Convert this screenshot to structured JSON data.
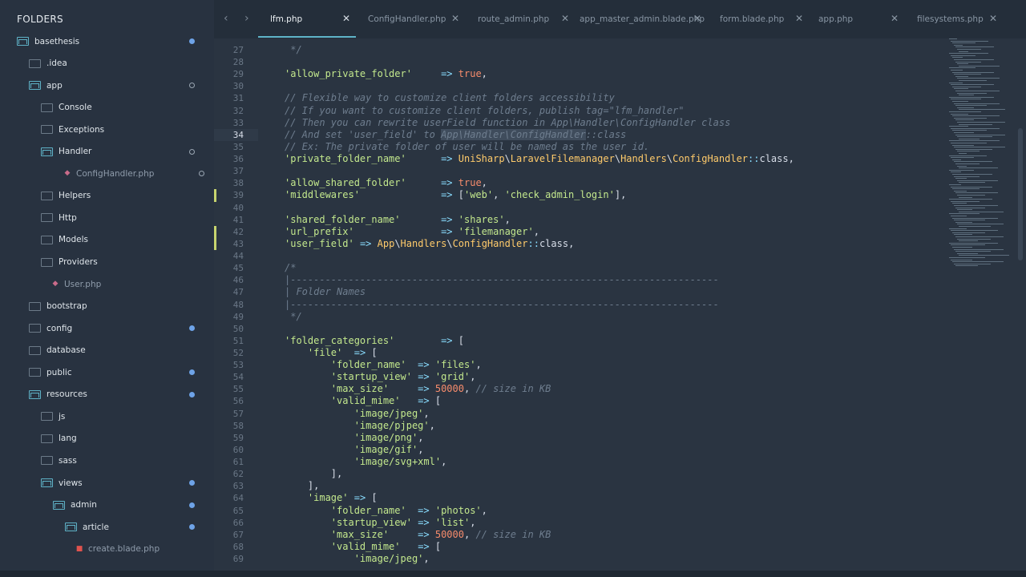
{
  "sidebar": {
    "header": "FOLDERS",
    "items": [
      {
        "label": "basethesis",
        "kind": "folder-open",
        "indent": 0,
        "marker": "fill"
      },
      {
        "label": ".idea",
        "kind": "folder",
        "indent": 1,
        "marker": ""
      },
      {
        "label": "app",
        "kind": "folder-open",
        "indent": 1,
        "marker": "ring"
      },
      {
        "label": "Console",
        "kind": "folder",
        "indent": 2,
        "marker": ""
      },
      {
        "label": "Exceptions",
        "kind": "folder",
        "indent": 2,
        "marker": ""
      },
      {
        "label": "Handler",
        "kind": "folder-open",
        "indent": 2,
        "marker": "ring"
      },
      {
        "label": "ConfigHandler.php",
        "kind": "php",
        "indent": 3,
        "marker": "ring"
      },
      {
        "label": "Helpers",
        "kind": "folder",
        "indent": 2,
        "marker": ""
      },
      {
        "label": "Http",
        "kind": "folder",
        "indent": 2,
        "marker": ""
      },
      {
        "label": "Models",
        "kind": "folder",
        "indent": 2,
        "marker": ""
      },
      {
        "label": "Providers",
        "kind": "folder",
        "indent": 2,
        "marker": ""
      },
      {
        "label": "User.php",
        "kind": "php",
        "indent": 2,
        "marker": ""
      },
      {
        "label": "bootstrap",
        "kind": "folder",
        "indent": 1,
        "marker": ""
      },
      {
        "label": "config",
        "kind": "folder",
        "indent": 1,
        "marker": "fill"
      },
      {
        "label": "database",
        "kind": "folder",
        "indent": 1,
        "marker": ""
      },
      {
        "label": "public",
        "kind": "folder",
        "indent": 1,
        "marker": "fill"
      },
      {
        "label": "resources",
        "kind": "folder-open",
        "indent": 1,
        "marker": "fill"
      },
      {
        "label": "js",
        "kind": "folder",
        "indent": 2,
        "marker": ""
      },
      {
        "label": "lang",
        "kind": "folder",
        "indent": 2,
        "marker": ""
      },
      {
        "label": "sass",
        "kind": "folder",
        "indent": 2,
        "marker": ""
      },
      {
        "label": "views",
        "kind": "folder-open",
        "indent": 2,
        "marker": "fill"
      },
      {
        "label": "admin",
        "kind": "folder-open",
        "indent": 3,
        "marker": "fill"
      },
      {
        "label": "article",
        "kind": "folder-open",
        "indent": 4,
        "marker": "fill"
      },
      {
        "label": "create.blade.php",
        "kind": "blade",
        "indent": 4,
        "marker": ""
      }
    ]
  },
  "tabs": [
    {
      "label": "lfm.php",
      "active": true
    },
    {
      "label": "ConfigHandler.php",
      "active": false
    },
    {
      "label": "route_admin.php",
      "active": false
    },
    {
      "label": "app_master_admin.blade.php",
      "active": false
    },
    {
      "label": "form.blade.php",
      "active": false
    },
    {
      "label": "app.php",
      "active": false
    },
    {
      "label": "filesystems.php",
      "active": false
    }
  ],
  "icons": {
    "back": "chevron-left-icon",
    "forward": "chevron-right-icon",
    "close": "close-icon"
  },
  "editor": {
    "current_line": 34,
    "lines": [
      {
        "n": 27,
        "t": [
          [
            "c",
            " */"
          ]
        ]
      },
      {
        "n": 28,
        "t": []
      },
      {
        "n": 29,
        "t": [
          [
            "s",
            "'allow_private_folder'"
          ],
          [
            "p",
            "     "
          ],
          [
            "o",
            "=>"
          ],
          [
            "p",
            " "
          ],
          [
            "k",
            "true"
          ],
          [
            "p",
            ","
          ]
        ]
      },
      {
        "n": 30,
        "t": []
      },
      {
        "n": 31,
        "t": [
          [
            "c",
            "// Flexible way to customize client folders accessibility"
          ]
        ]
      },
      {
        "n": 32,
        "t": [
          [
            "c",
            "// If you want to customize client folders, publish tag=\"lfm_handler\""
          ]
        ]
      },
      {
        "n": 33,
        "t": [
          [
            "c",
            "// Then you can rewrite userField function in App\\Handler\\ConfigHandler class"
          ]
        ]
      },
      {
        "n": 34,
        "t": [
          [
            "c",
            "// And set 'user_field' to "
          ],
          [
            "csel",
            "App\\Handler\\ConfigHandler"
          ],
          [
            "c",
            "::class"
          ]
        ]
      },
      {
        "n": 35,
        "t": [
          [
            "c",
            "// Ex: The private folder of user will be named as the user id."
          ]
        ]
      },
      {
        "n": 36,
        "t": [
          [
            "s",
            "'private_folder_name'"
          ],
          [
            "p",
            "      "
          ],
          [
            "o",
            "=>"
          ],
          [
            "p",
            " "
          ],
          [
            "cls",
            "UniSharp"
          ],
          [
            "p",
            "\\"
          ],
          [
            "cls",
            "LaravelFilemanager"
          ],
          [
            "p",
            "\\"
          ],
          [
            "cls",
            "Handlers"
          ],
          [
            "p",
            "\\"
          ],
          [
            "cls",
            "ConfigHandler"
          ],
          [
            "o",
            "::"
          ],
          [
            "p",
            "class,"
          ]
        ]
      },
      {
        "n": 37,
        "t": []
      },
      {
        "n": 38,
        "t": [
          [
            "s",
            "'allow_shared_folder'"
          ],
          [
            "p",
            "      "
          ],
          [
            "o",
            "=>"
          ],
          [
            "p",
            " "
          ],
          [
            "k",
            "true"
          ],
          [
            "p",
            ","
          ]
        ]
      },
      {
        "n": 39,
        "t": [
          [
            "s",
            "'middlewares'"
          ],
          [
            "p",
            "              "
          ],
          [
            "o",
            "=>"
          ],
          [
            "p",
            " ["
          ],
          [
            "s",
            "'web'"
          ],
          [
            "p",
            ", "
          ],
          [
            "s",
            "'check_admin_login'"
          ],
          [
            "p",
            "],"
          ]
        ]
      },
      {
        "n": 40,
        "t": []
      },
      {
        "n": 41,
        "t": [
          [
            "s",
            "'shared_folder_name'"
          ],
          [
            "p",
            "       "
          ],
          [
            "o",
            "=>"
          ],
          [
            "p",
            " "
          ],
          [
            "s",
            "'shares'"
          ],
          [
            "p",
            ","
          ]
        ]
      },
      {
        "n": 42,
        "t": [
          [
            "s",
            "'url_prefix'"
          ],
          [
            "p",
            "               "
          ],
          [
            "o",
            "=>"
          ],
          [
            "p",
            " "
          ],
          [
            "s",
            "'filemanager'"
          ],
          [
            "p",
            ","
          ]
        ]
      },
      {
        "n": 43,
        "t": [
          [
            "s",
            "'user_field'"
          ],
          [
            "p",
            " "
          ],
          [
            "o",
            "=>"
          ],
          [
            "p",
            " "
          ],
          [
            "cls",
            "App"
          ],
          [
            "p",
            "\\"
          ],
          [
            "cls",
            "Handlers"
          ],
          [
            "p",
            "\\"
          ],
          [
            "cls",
            "ConfigHandler"
          ],
          [
            "o",
            "::"
          ],
          [
            "p",
            "class,"
          ]
        ]
      },
      {
        "n": 44,
        "t": []
      },
      {
        "n": 45,
        "t": [
          [
            "c",
            "/*"
          ]
        ]
      },
      {
        "n": 46,
        "t": [
          [
            "c",
            "|--------------------------------------------------------------------------"
          ]
        ]
      },
      {
        "n": 47,
        "t": [
          [
            "c",
            "| Folder Names"
          ]
        ]
      },
      {
        "n": 48,
        "t": [
          [
            "c",
            "|--------------------------------------------------------------------------"
          ]
        ]
      },
      {
        "n": 49,
        "t": [
          [
            "c",
            " */"
          ]
        ]
      },
      {
        "n": 50,
        "t": []
      },
      {
        "n": 51,
        "t": [
          [
            "s",
            "'folder_categories'"
          ],
          [
            "p",
            "        "
          ],
          [
            "o",
            "=>"
          ],
          [
            "p",
            " ["
          ]
        ]
      },
      {
        "n": 52,
        "t": [
          [
            "p",
            "    "
          ],
          [
            "s",
            "'file'"
          ],
          [
            "p",
            "  "
          ],
          [
            "o",
            "=>"
          ],
          [
            "p",
            " ["
          ]
        ]
      },
      {
        "n": 53,
        "t": [
          [
            "p",
            "        "
          ],
          [
            "s",
            "'folder_name'"
          ],
          [
            "p",
            "  "
          ],
          [
            "o",
            "=>"
          ],
          [
            "p",
            " "
          ],
          [
            "s",
            "'files'"
          ],
          [
            "p",
            ","
          ]
        ]
      },
      {
        "n": 54,
        "t": [
          [
            "p",
            "        "
          ],
          [
            "s",
            "'startup_view'"
          ],
          [
            "p",
            " "
          ],
          [
            "o",
            "=>"
          ],
          [
            "p",
            " "
          ],
          [
            "s",
            "'grid'"
          ],
          [
            "p",
            ","
          ]
        ]
      },
      {
        "n": 55,
        "t": [
          [
            "p",
            "        "
          ],
          [
            "s",
            "'max_size'"
          ],
          [
            "p",
            "     "
          ],
          [
            "o",
            "=>"
          ],
          [
            "p",
            " "
          ],
          [
            "n",
            "50000"
          ],
          [
            "p",
            ", "
          ],
          [
            "c",
            "// size in KB"
          ]
        ]
      },
      {
        "n": 56,
        "t": [
          [
            "p",
            "        "
          ],
          [
            "s",
            "'valid_mime'"
          ],
          [
            "p",
            "   "
          ],
          [
            "o",
            "=>"
          ],
          [
            "p",
            " ["
          ]
        ]
      },
      {
        "n": 57,
        "t": [
          [
            "p",
            "            "
          ],
          [
            "s",
            "'image/jpeg'"
          ],
          [
            "p",
            ","
          ]
        ]
      },
      {
        "n": 58,
        "t": [
          [
            "p",
            "            "
          ],
          [
            "s",
            "'image/pjpeg'"
          ],
          [
            "p",
            ","
          ]
        ]
      },
      {
        "n": 59,
        "t": [
          [
            "p",
            "            "
          ],
          [
            "s",
            "'image/png'"
          ],
          [
            "p",
            ","
          ]
        ]
      },
      {
        "n": 60,
        "t": [
          [
            "p",
            "            "
          ],
          [
            "s",
            "'image/gif'"
          ],
          [
            "p",
            ","
          ]
        ]
      },
      {
        "n": 61,
        "t": [
          [
            "p",
            "            "
          ],
          [
            "s",
            "'image/svg+xml'"
          ],
          [
            "p",
            ","
          ]
        ]
      },
      {
        "n": 62,
        "t": [
          [
            "p",
            "        ],"
          ]
        ]
      },
      {
        "n": 63,
        "t": [
          [
            "p",
            "    ],"
          ]
        ]
      },
      {
        "n": 64,
        "t": [
          [
            "p",
            "    "
          ],
          [
            "s",
            "'image'"
          ],
          [
            "p",
            " "
          ],
          [
            "o",
            "=>"
          ],
          [
            "p",
            " ["
          ]
        ]
      },
      {
        "n": 65,
        "t": [
          [
            "p",
            "        "
          ],
          [
            "s",
            "'folder_name'"
          ],
          [
            "p",
            "  "
          ],
          [
            "o",
            "=>"
          ],
          [
            "p",
            " "
          ],
          [
            "s",
            "'photos'"
          ],
          [
            "p",
            ","
          ]
        ]
      },
      {
        "n": 66,
        "t": [
          [
            "p",
            "        "
          ],
          [
            "s",
            "'startup_view'"
          ],
          [
            "p",
            " "
          ],
          [
            "o",
            "=>"
          ],
          [
            "p",
            " "
          ],
          [
            "s",
            "'list'"
          ],
          [
            "p",
            ","
          ]
        ]
      },
      {
        "n": 67,
        "t": [
          [
            "p",
            "        "
          ],
          [
            "s",
            "'max_size'"
          ],
          [
            "p",
            "     "
          ],
          [
            "o",
            "=>"
          ],
          [
            "p",
            " "
          ],
          [
            "n",
            "50000"
          ],
          [
            "p",
            ", "
          ],
          [
            "c",
            "// size in KB"
          ]
        ]
      },
      {
        "n": 68,
        "t": [
          [
            "p",
            "        "
          ],
          [
            "s",
            "'valid_mime'"
          ],
          [
            "p",
            "   "
          ],
          [
            "o",
            "=>"
          ],
          [
            "p",
            " ["
          ]
        ]
      },
      {
        "n": 69,
        "t": [
          [
            "p",
            "            "
          ],
          [
            "s",
            "'image/jpeg'"
          ],
          [
            "p",
            ","
          ]
        ]
      }
    ]
  },
  "colors": {
    "accent": "#5fb3c8",
    "modified_dot": "#6ea3e8",
    "gutter_modified": "#c7d46e"
  }
}
